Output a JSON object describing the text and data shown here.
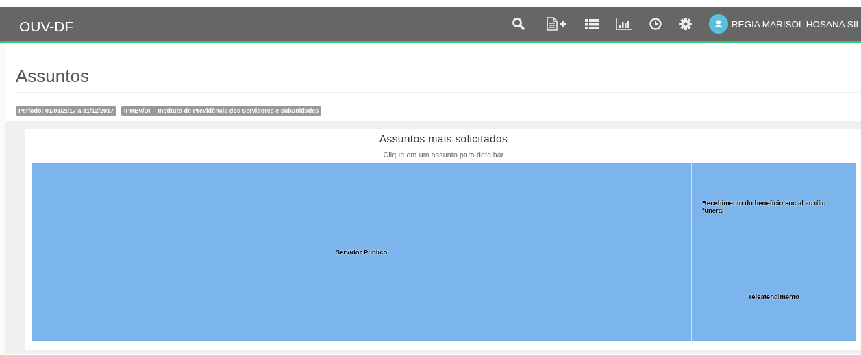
{
  "navbar": {
    "brand": "OUV-DF",
    "user": "REGIA MARISOL HOSANA SIL"
  },
  "page": {
    "title": "Assuntos"
  },
  "filters": [
    "Período: 01/01/2017 a 31/12/2017",
    "IPREV/DF - Instituto de Previdência dos Servidores e subunidades"
  ],
  "chart": {
    "title": "Assuntos mais solicitados",
    "subtitle": "Clique em um assunto para detalhar",
    "tiles": [
      {
        "label": "Servidor Público"
      },
      {
        "label": "Recebimento do benefício social auxílio funeral"
      },
      {
        "label": "Teleatendimento"
      }
    ]
  }
}
